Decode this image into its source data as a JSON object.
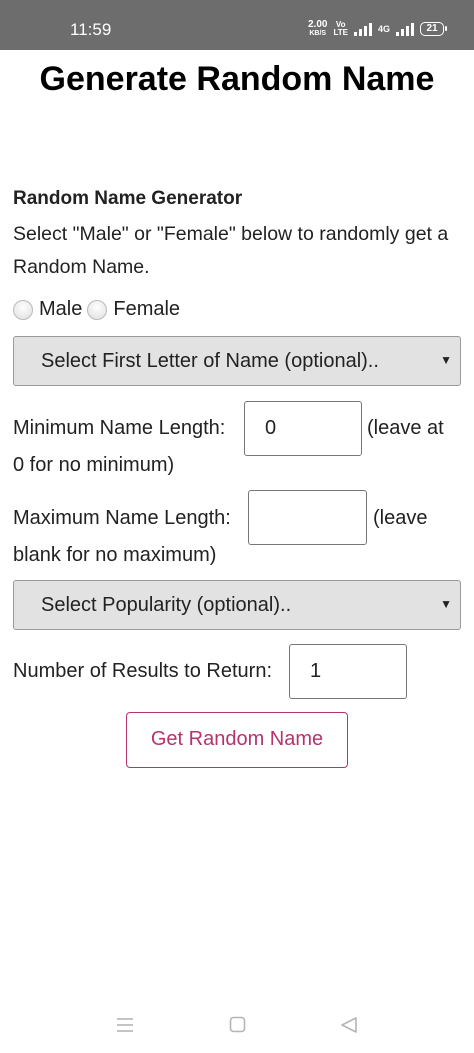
{
  "status_bar": {
    "time": "11:59",
    "speed_value": "2.00",
    "speed_unit": "KB/S",
    "volte_top": "Vo",
    "volte_bottom": "LTE",
    "network": "4G",
    "battery": "21"
  },
  "page": {
    "title": "Generate Random Name"
  },
  "form": {
    "heading": "Random Name Generator",
    "instructions": "Select \"Male\" or \"Female\" below to randomly get a Random Name.",
    "gender_options": [
      "Male",
      "Female"
    ],
    "first_letter_select": "Select First Letter of Name (optional)..",
    "min_length_label": "Minimum Name Length:",
    "min_length_value": "0",
    "min_length_hint_a": "(leave at",
    "min_length_hint_b": "0 for no minimum)",
    "max_length_label": "Maximum Name Length:",
    "max_length_value": "",
    "max_length_hint_a": "(leave",
    "max_length_hint_b": "blank for no maximum)",
    "popularity_select": "Select Popularity (optional)..",
    "results_label": "Number of Results to Return:",
    "results_value": "1",
    "submit_label": "Get Random Name",
    "select_arrow": "▼"
  },
  "colors": {
    "accent": "#b5336f",
    "status_bar": "#6d6d6d",
    "select_bg": "#e2e2e2"
  },
  "icons": {
    "nav_menu": "menu-icon",
    "nav_home": "home-square-icon",
    "nav_back": "back-triangle-icon"
  }
}
